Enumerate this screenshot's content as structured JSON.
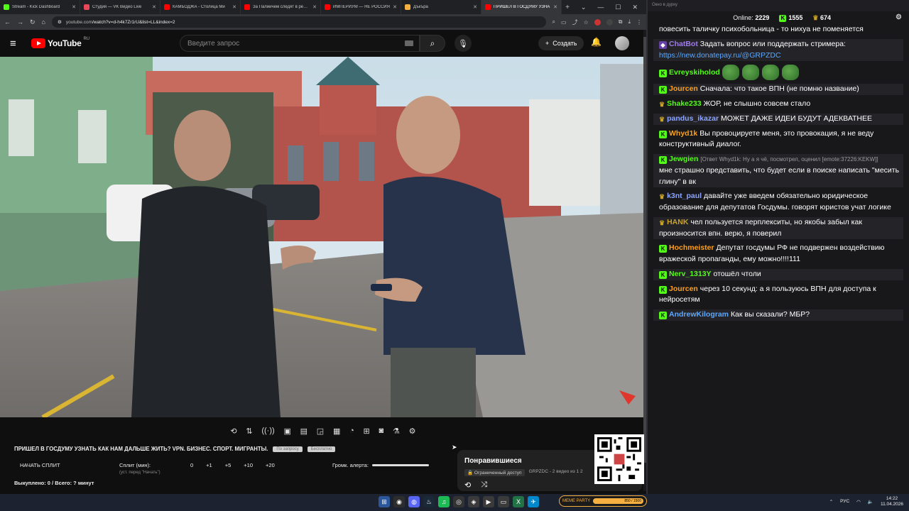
{
  "browser": {
    "tabs": [
      {
        "title": "Stream - Kick Dashboard",
        "color": "#53fc18"
      },
      {
        "title": "Студия — VK Видео Live",
        "color": "#e8465a"
      },
      {
        "title": "КАМБОДЖА - Столица Ми",
        "color": "#ff0000"
      },
      {
        "title": "За Палиичем следят в реальн",
        "color": "#ff0000"
      },
      {
        "title": "ИМПЕРИУМ — НЕ РОССИЯ",
        "color": "#ff0000"
      },
      {
        "title": "Дъкъра",
        "color": "#f5b041"
      },
      {
        "title": "ПРИШЕЛ В ГОСДУМУ УЗНА",
        "color": "#ff0000",
        "active": true
      }
    ],
    "url_site": "youtube.com",
    "url_rest": "/watch?v=d-h4k7Zr1rU&list=LL&index=2"
  },
  "youtube": {
    "logo_text": "YouTube",
    "region": "RU",
    "search_placeholder": "Введите запрос",
    "create_label": "Создать"
  },
  "video": {
    "title": "ПРИШЕЛ В ГОСДУМУ УЗНАТЬ КАК НАМ ДАЛЬШЕ ЖИТЬ? VPN. БИЗНЕС. СПОРТ. МИГРАНТЫ.",
    "chip1": "По запросу",
    "chip2": "Бесплатно",
    "split_button": "НАЧАТЬ СПЛИТ",
    "split_label": "Сплит (мин):",
    "split_sub": "(уст. перед \"Начать\")",
    "split_values": [
      "0",
      "+1",
      "+5",
      "+10",
      "+20"
    ],
    "alert_label": "Громк. алерта:",
    "done_text": "Выкуплено: 0 / Всего: ? минут"
  },
  "liked": {
    "heading": "Понравившиеся",
    "access": "Ограниченный доступ",
    "channel": "GRPZDC - 2 видео из 1 2"
  },
  "chat": {
    "window_title": "Окно в дурку",
    "online_label": "Online:",
    "online_value": "2229",
    "kick_value": "1555",
    "sub_value": "674",
    "messages": [
      {
        "user": "",
        "color": "#ffffff",
        "badge": "",
        "text": "повесить таличку психобольница - то нихуа не поменяется"
      },
      {
        "user": "ChatBot",
        "color": "#9f7aea",
        "badge": "bot",
        "text": "Задать вопрос или поддержать стримера: ",
        "link": "https://new.donatepay.ru/@GRPZDC"
      },
      {
        "user": "Evreyskiholod",
        "color": "#53fc18",
        "badge": "kick",
        "text": "",
        "frogs": 4
      },
      {
        "user": "Jourcen",
        "color": "#ff9f1a",
        "badge": "kick",
        "text": "Сначала: что такое ВПН (не помню название)"
      },
      {
        "user": "Shake233",
        "color": "#53fc18",
        "badge": "sub",
        "text": "ЖОР, не слышно совсем стало"
      },
      {
        "user": "pandus_ikazar",
        "color": "#8aa4ff",
        "badge": "sub",
        "text": "МОЖЕТ ДАЖЕ ИДЕИ БУДУТ АДЕКВАТНЕЕ"
      },
      {
        "user": "Whyd1k",
        "color": "#ff9f1a",
        "badge": "kick",
        "text": "Вы провоцируете меня, это провокация, я не веду конструктивный диалог."
      },
      {
        "user": "Jewgien",
        "color": "#53fc18",
        "badge": "kick",
        "reply": "[Ответ Whyd1k: Ну а я чё, посмотрел, оценил [emote:37226:KEKW]]",
        "text": "мне страшно представить, что будет если в поиске написать \"месить глину\" в вк"
      },
      {
        "user": "k3nt_paul",
        "color": "#8aa4ff",
        "badge": "sub",
        "text": "давайте уже введем обязательно юридическое образование для депутатов Госдумы. говорят юристов учат логике"
      },
      {
        "user": "HANK",
        "color": "#c9a227",
        "badge": "sub",
        "text": "чел пользуется перплекситы, но якобы забыл как произносится впн. верю, я поверил"
      },
      {
        "user": "Hochmeister",
        "color": "#ff9f1a",
        "badge": "kick",
        "text": "Депутат госдумы РФ не подвержен воздействию вражеской пропаганды, ему можно!!!!111"
      },
      {
        "user": "Nerv_1313Y",
        "color": "#53fc18",
        "badge": "kick",
        "text": "отошёл чтоли"
      },
      {
        "user": "Jourcen",
        "color": "#ff9f1a",
        "badge": "kick",
        "text": "через 10 секунд: а я пользуюсь ВПН для доступа к нейросетям"
      },
      {
        "user": "AndrewKilogram",
        "color": "#5aa8ff",
        "badge": "kick",
        "text": "Как вы сказали? МБР?"
      }
    ]
  },
  "taskbar": {
    "meme_label": "MEME PARTY",
    "meme_progress": "850 / 1500",
    "lang": "РУС",
    "time": "14:22",
    "date": "11.04.2026"
  }
}
